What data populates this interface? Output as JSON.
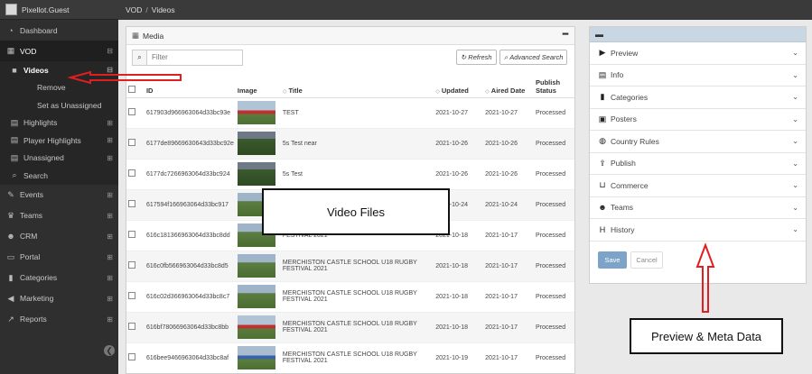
{
  "user": {
    "name": "Pixellot.Guest"
  },
  "breadcrumb": {
    "root": "VOD",
    "separator": "/",
    "current": "Videos"
  },
  "sidebar": {
    "items": [
      {
        "label": "Dashboard",
        "icon": "dashboard-icon"
      },
      {
        "label": "VOD",
        "icon": "film-icon",
        "toggle": "⊟"
      },
      {
        "label": "Events",
        "icon": "wrench-icon",
        "toggle": "⊞"
      },
      {
        "label": "Teams",
        "icon": "trophy-icon",
        "toggle": "⊞"
      },
      {
        "label": "CRM",
        "icon": "users-icon",
        "toggle": "⊞"
      },
      {
        "label": "Portal",
        "icon": "monitor-icon",
        "toggle": "⊞"
      },
      {
        "label": "Categories",
        "icon": "bookmark-icon",
        "toggle": "⊞"
      },
      {
        "label": "Marketing",
        "icon": "bullhorn-icon",
        "toggle": "⊞"
      },
      {
        "label": "Reports",
        "icon": "chart-icon",
        "toggle": "⊞"
      }
    ],
    "vod_sub": [
      {
        "label": "Videos",
        "icon": "video-camera-icon",
        "toggle": "⊟"
      },
      {
        "label": "Remove"
      },
      {
        "label": "Set as Unassigned"
      },
      {
        "label": "Highlights",
        "icon": "file-icon",
        "toggle": "⊞"
      },
      {
        "label": "Player Highlights",
        "icon": "file-icon",
        "toggle": "⊞"
      },
      {
        "label": "Unassigned",
        "icon": "file-icon",
        "toggle": "⊞"
      },
      {
        "label": "Search",
        "icon": "search-icon"
      }
    ],
    "collapse": "❮"
  },
  "media": {
    "title": "Media",
    "filter_placeholder": "Filter",
    "refresh_label": "Refresh",
    "advanced_search_label": "Advanced Search",
    "columns": [
      "ID",
      "Image",
      "Title",
      "Updated",
      "Aired Date",
      "Publish Status"
    ],
    "rows": [
      {
        "id": "617903d966963064d33bc93e",
        "title": "TEST",
        "updated": "2021-10-27",
        "aired": "2021-10-27",
        "status": "Processed",
        "thumb": "red"
      },
      {
        "id": "6177de89669630643d33bc92e",
        "title": "5s Test near",
        "updated": "2021-10-26",
        "aired": "2021-10-26",
        "status": "Processed",
        "thumb": "dark"
      },
      {
        "id": "6177dc7266963064d33bc924",
        "title": "5s Test",
        "updated": "2021-10-26",
        "aired": "2021-10-26",
        "status": "Processed",
        "thumb": "dark"
      },
      {
        "id": "617594f166963064d33bc917",
        "title": "",
        "updated": "2021-10-24",
        "aired": "2021-10-24",
        "status": "Processed",
        "thumb": "green"
      },
      {
        "id": "616c181366963064d33bc8dd",
        "title": "FESTIVAL 2021",
        "updated": "2021-10-18",
        "aired": "2021-10-17",
        "status": "Processed",
        "thumb": "green"
      },
      {
        "id": "616c0fb566963064d33bc8d5",
        "title": "MERCHISTON CASTLE SCHOOL U18 RUGBY FESTIVAL 2021",
        "updated": "2021-10-18",
        "aired": "2021-10-17",
        "status": "Processed",
        "thumb": "green"
      },
      {
        "id": "616c02d366963064d33bc8c7",
        "title": "MERCHISTON CASTLE SCHOOL U18 RUGBY FESTIVAL 2021",
        "updated": "2021-10-18",
        "aired": "2021-10-17",
        "status": "Processed",
        "thumb": "green"
      },
      {
        "id": "616bf78066963064d33bc8bb",
        "title": "MERCHISTON CASTLE SCHOOL U18 RUGBY FESTIVAL 2021",
        "updated": "2021-10-18",
        "aired": "2021-10-17",
        "status": "Processed",
        "thumb": "red"
      },
      {
        "id": "616bee9466963064d33bc8af",
        "title": "MERCHISTON CASTLE SCHOOL U18 RUGBY FESTIVAL 2021",
        "updated": "2021-10-19",
        "aired": "2021-10-17",
        "status": "Processed",
        "thumb": "blue"
      }
    ]
  },
  "meta": {
    "sections": [
      {
        "label": "Preview",
        "icon": "play-icon"
      },
      {
        "label": "Info",
        "icon": "file-icon"
      },
      {
        "label": "Categories",
        "icon": "bookmark-icon"
      },
      {
        "label": "Posters",
        "icon": "image-icon"
      },
      {
        "label": "Country Rules",
        "icon": "globe-icon"
      },
      {
        "label": "Publish",
        "icon": "upload-icon"
      },
      {
        "label": "Commerce",
        "icon": "cart-icon"
      },
      {
        "label": "Teams",
        "icon": "users-icon"
      },
      {
        "label": "History",
        "icon": "history-icon"
      }
    ],
    "save_label": "Save",
    "cancel_label": "Cancel"
  },
  "annotations": {
    "video_files": "Video Files",
    "preview_meta": "Preview & Meta Data"
  },
  "colors": {
    "sidebar": "#2f2f2f",
    "topbar": "#3a3a3a",
    "save": "#7ea3c9",
    "arrow": "#e02020",
    "meta_head": "#c9d6e3"
  }
}
